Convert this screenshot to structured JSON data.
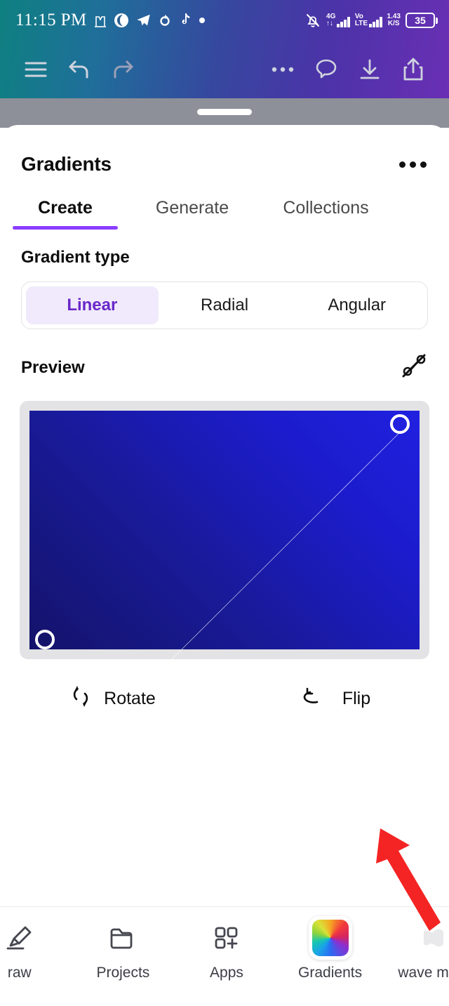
{
  "status_bar": {
    "time": "11:15 PM",
    "notification_icons": [
      "pm-glyph-icon",
      "moon-circle-icon",
      "telegram-icon",
      "loop-icon",
      "tiktok-icon",
      "dot-icon"
    ],
    "mute_icon": "bell-muted-icon",
    "network_1": {
      "tech": "4G",
      "sub": "↑↓"
    },
    "network_2": {
      "tech": "Vo",
      "sub": "LTE"
    },
    "data_speed": {
      "value": "1.43",
      "unit": "K/S"
    },
    "battery_percent": "35"
  },
  "toolbar": {
    "menu_icon": "hamburger-menu-icon",
    "undo_icon": "undo-icon",
    "redo_icon": "redo-icon",
    "more_icon": "more-horizontal-icon",
    "comment_icon": "comment-bubble-icon",
    "download_icon": "download-icon",
    "share_icon": "share-upload-icon"
  },
  "sheet": {
    "drag_handle": "sheet-drag-handle",
    "title": "Gradients",
    "overflow_icon": "more-horizontal-icon",
    "tabs": [
      {
        "label": "Create",
        "active": true
      },
      {
        "label": "Generate",
        "active": false
      },
      {
        "label": "Collections",
        "active": false
      }
    ],
    "gradient_type": {
      "label": "Gradient type",
      "options": [
        {
          "label": "Linear",
          "selected": true
        },
        {
          "label": "Radial",
          "selected": false
        },
        {
          "label": "Angular",
          "selected": false
        }
      ]
    },
    "preview": {
      "label": "Preview",
      "toggle_handles_icon": "hide-handles-icon",
      "gradient": {
        "type": "linear",
        "angle_deg": 45,
        "start_color": "#14136b",
        "end_color": "#2121de",
        "start_handle": {
          "x_pct": 4,
          "y_pct": 96
        },
        "end_handle": {
          "x_pct": 95,
          "y_pct": 5
        }
      }
    },
    "actions": [
      {
        "label": "Rotate",
        "icon": "rotate-icon"
      },
      {
        "label": "Flip",
        "icon": "flip-icon"
      }
    ]
  },
  "bottom_nav": [
    {
      "label": "raw",
      "icon": "draw-pen-icon",
      "active": false
    },
    {
      "label": "Projects",
      "icon": "folder-icon",
      "active": false
    },
    {
      "label": "Apps",
      "icon": "apps-grid-plus-icon",
      "active": false
    },
    {
      "label": "Gradients",
      "icon": "color-wheel-icon",
      "active": true
    },
    {
      "label": "wave ma...",
      "icon": "wave-icon",
      "active": false
    }
  ],
  "annotation": {
    "arrow_icon": "red-pointer-arrow",
    "color": "#f42424"
  },
  "theme": {
    "accent_purple": "#8b3dff",
    "chip_purple_text": "#6a28c9",
    "chip_purple_bg": "#f0eafc",
    "header_gradient_start": "#0e8080",
    "header_gradient_end": "#6a2fb5"
  }
}
